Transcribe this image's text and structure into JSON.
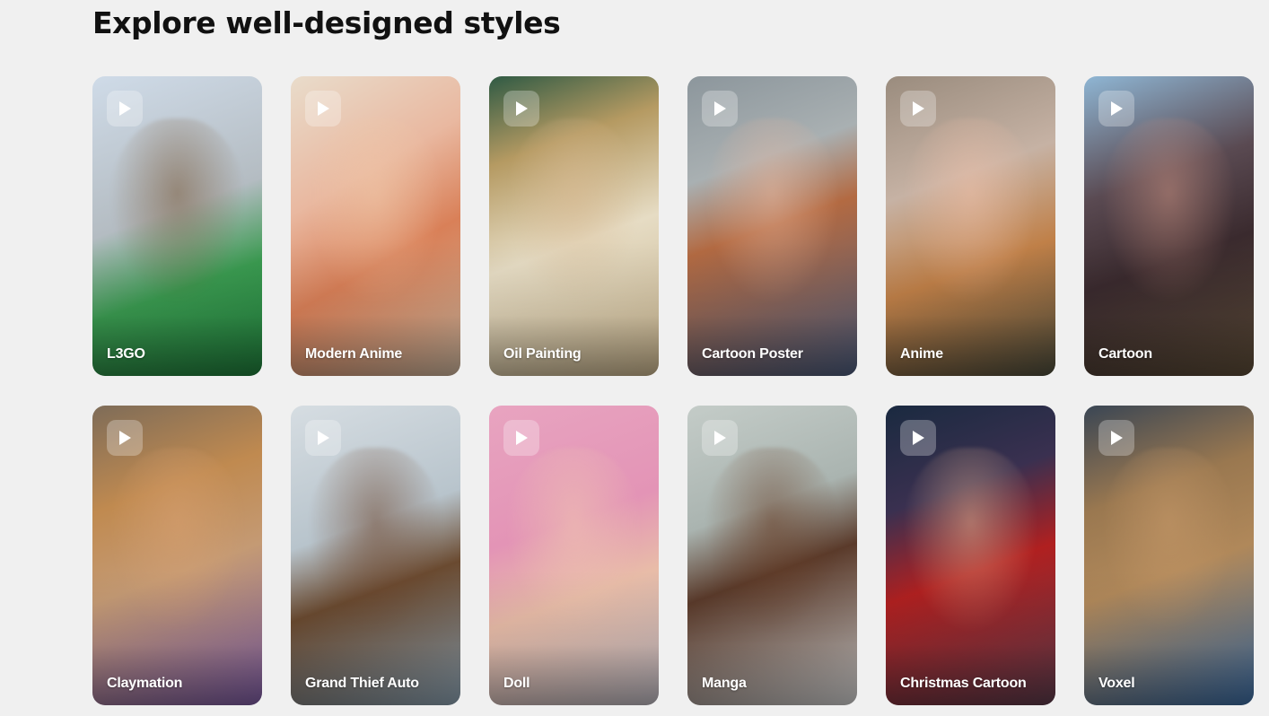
{
  "page": {
    "heading": "Explore well-designed styles"
  },
  "styles": [
    {
      "label": "L3GO",
      "bg": "linear-gradient(160deg,#cfdbe8 0%,#b4bcc2 45%,#3a9a50 68%,#1f7a3a 100%)",
      "glow": "#7a5a3a"
    },
    {
      "label": "Modern Anime",
      "bg": "linear-gradient(150deg,#e9dccb 0%,#e9b8a0 35%,#d98058 60%,#c9b29a 100%)",
      "glow": "#f0c8a8"
    },
    {
      "label": "Oil Painting",
      "bg": "linear-gradient(160deg,#2f5a44 0%,#b59a62 25%,#e6dcc4 55%,#c4b08a 100%)",
      "glow": "#d8b890"
    },
    {
      "label": "Cartoon Poster",
      "bg": "linear-gradient(160deg,#8c969c 0%,#a9b0b2 30%,#b36a42 50%,#4a5a7a 100%)",
      "glow": "#e8b8a0"
    },
    {
      "label": "Anime",
      "bg": "linear-gradient(160deg,#9a8c7e 0%,#c6b2a4 35%,#c08048 62%,#4a4a3a 100%)",
      "glow": "#f0c0a8"
    },
    {
      "label": "Cartoon",
      "bg": "linear-gradient(160deg,#8fb6d4 0%,#5a4a52 35%,#3a2a2e 60%,#5a4a36 100%)",
      "glow": "#c89080"
    },
    {
      "label": "Claymation",
      "bg": "linear-gradient(160deg,#7e6c58 0%,#c08a50 30%,#c49a74 55%,#7a5aa0 100%)",
      "glow": "#d8a070"
    },
    {
      "label": "Grand Thief Auto",
      "bg": "linear-gradient(160deg,#d6dde2 0%,#b8c4cc 40%,#6a4a30 60%,#8aa0b0 100%)",
      "glow": "#704830"
    },
    {
      "label": "Doll",
      "bg": "linear-gradient(160deg,#e8a4c0 0%,#e394b6 40%,#e8bca8 62%,#b8b4bc 100%)",
      "glow": "#f0c8b0"
    },
    {
      "label": "Manga",
      "bg": "linear-gradient(160deg,#c4ccc8 0%,#aab4b0 35%,#5a3a2a 55%,#cfcfcf 100%)",
      "glow": "#6a4028"
    },
    {
      "label": "Christmas Cartoon",
      "bg": "linear-gradient(160deg,#1a2a40 0%,#3a3050 30%,#b02020 55%,#5a3a4a 100%)",
      "glow": "#e0b090"
    },
    {
      "label": "Voxel",
      "bg": "linear-gradient(160deg,#3a4654 0%,#9a7850 30%,#b0885a 55%,#3a6aa0 100%)",
      "glow": "#c89a6a"
    }
  ],
  "icons": {
    "play": "play-icon"
  }
}
